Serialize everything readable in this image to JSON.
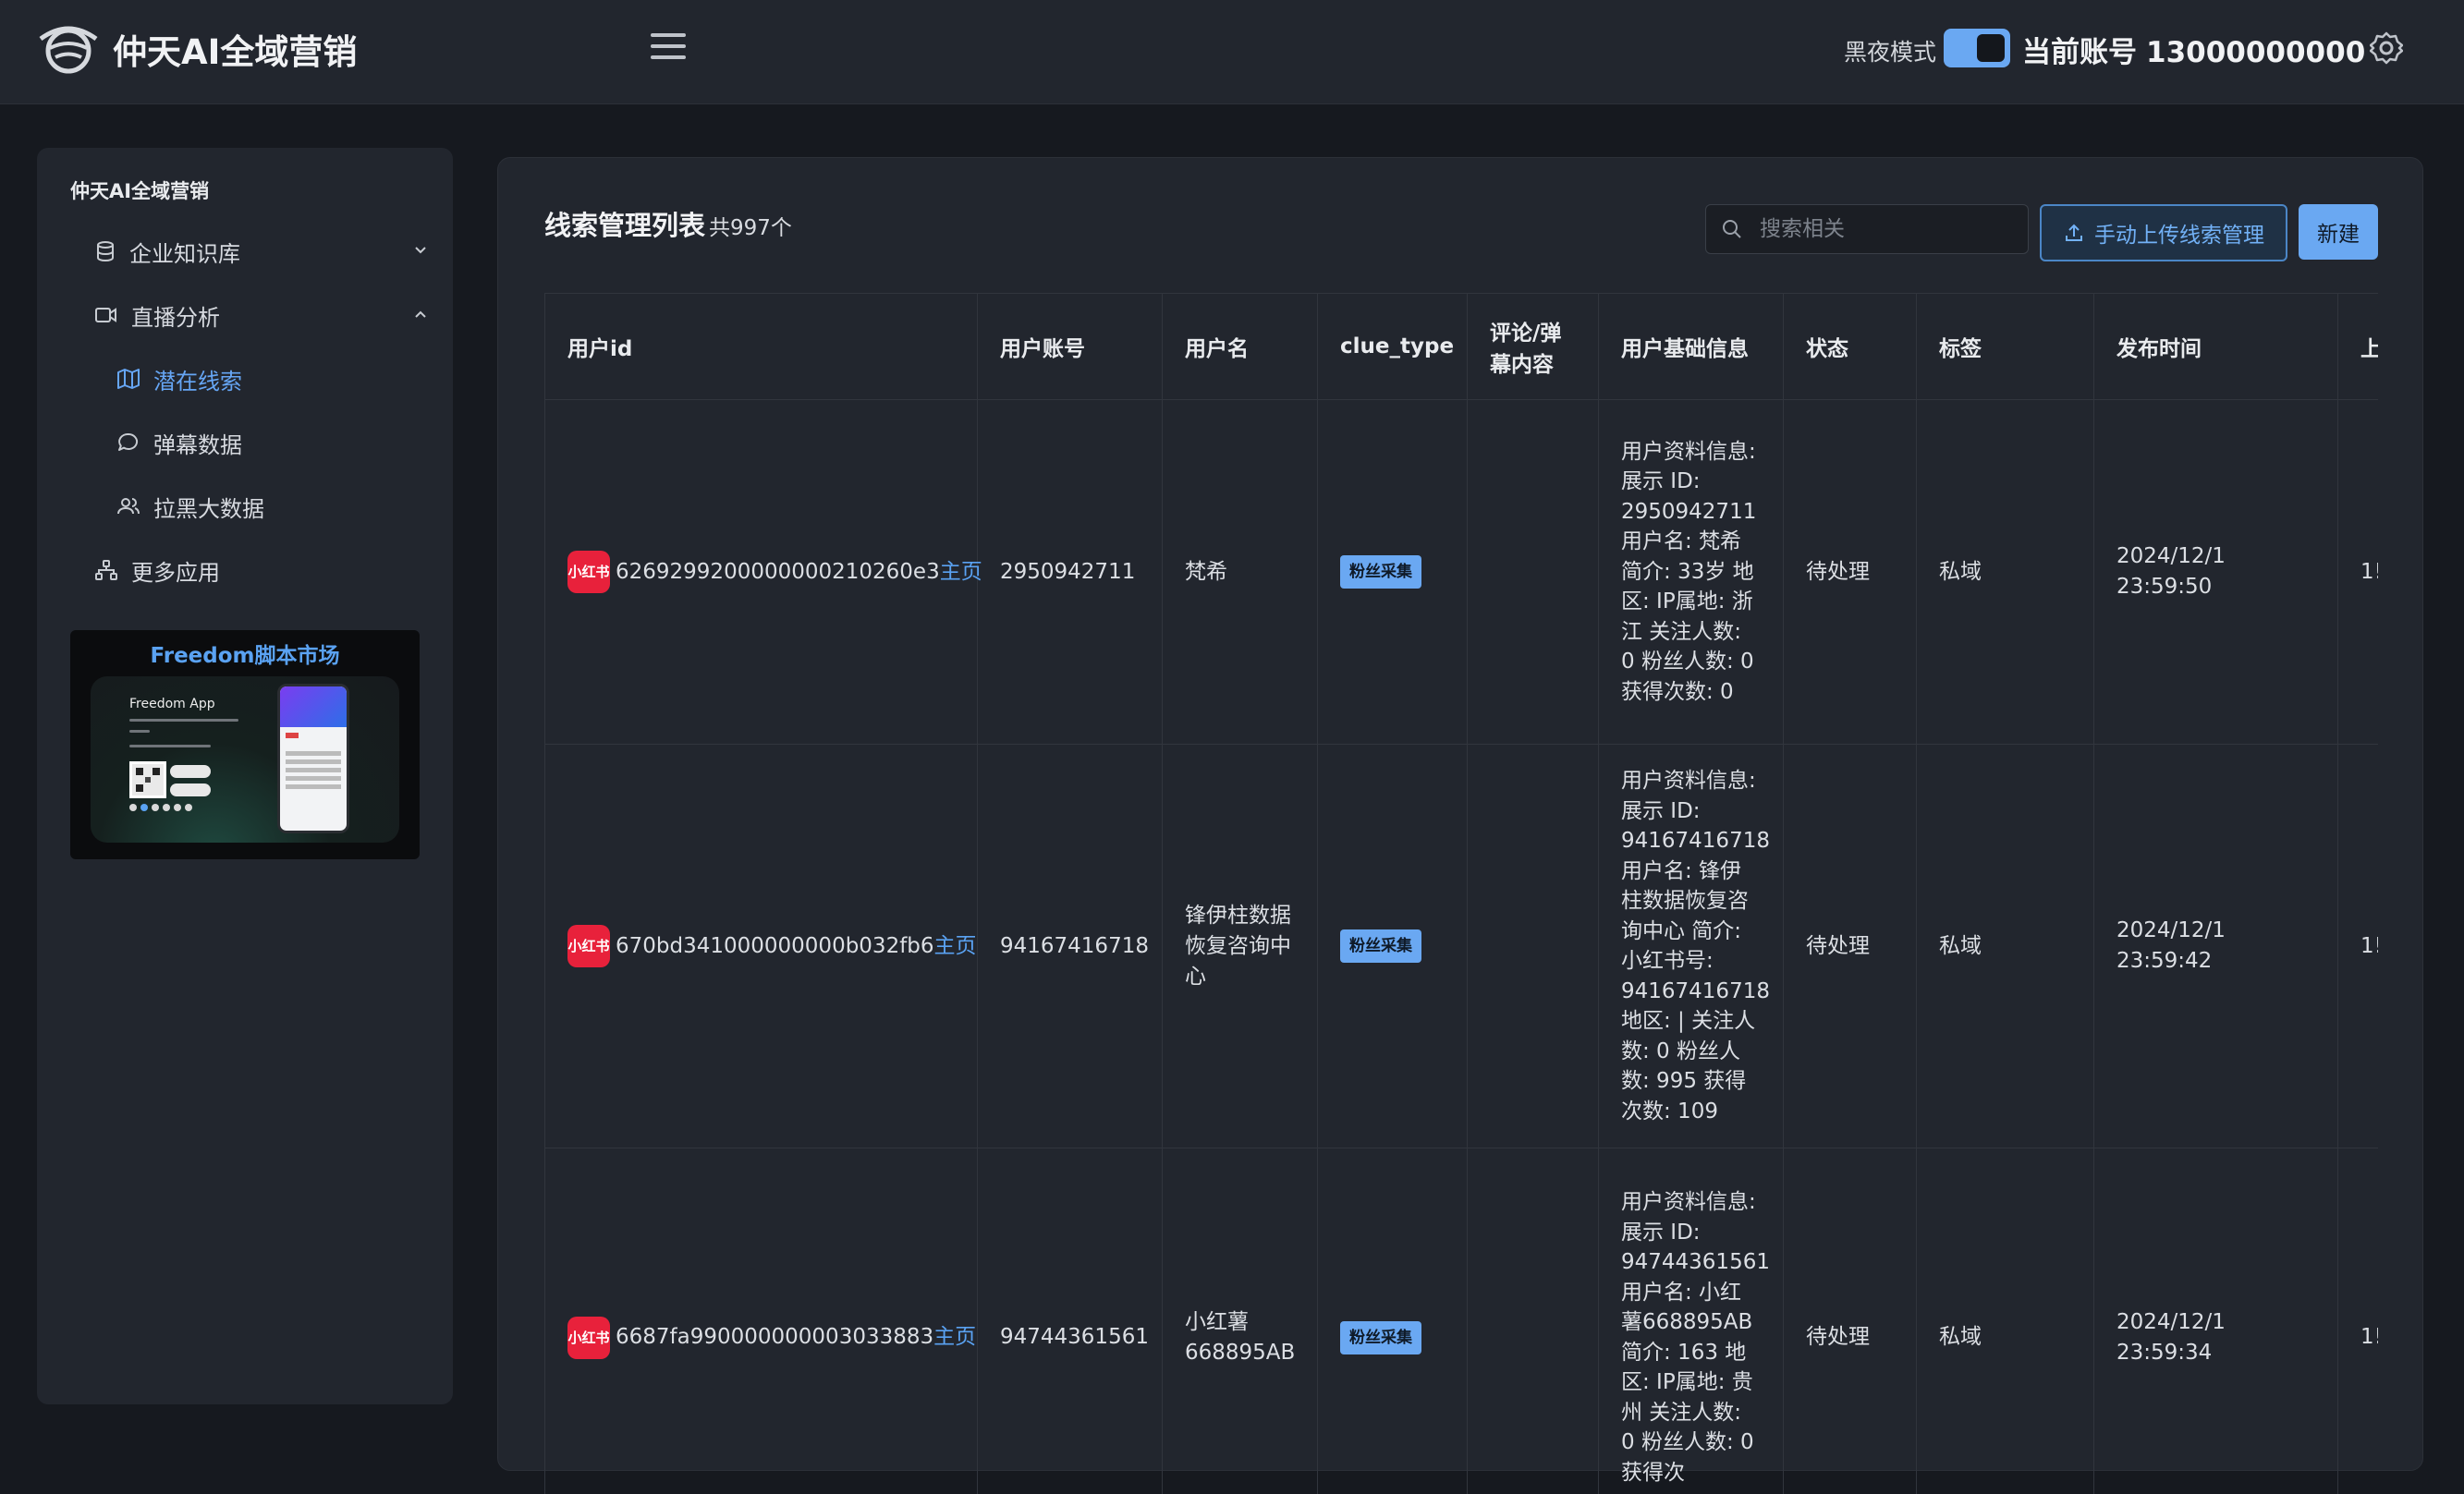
{
  "header": {
    "app_title": "仲天AI全域营销",
    "dark_mode_label": "黑夜模式",
    "dark_mode_on": true,
    "account_label": "当前账号",
    "account_number": "13000000000"
  },
  "sidebar": {
    "title": "仲天AI全域营销",
    "items": [
      {
        "label": "企业知识库",
        "icon": "database-icon",
        "expanded": false
      },
      {
        "label": "直播分析",
        "icon": "video-icon",
        "expanded": true
      },
      {
        "label": "潜在线索",
        "icon": "map-icon",
        "active": true
      },
      {
        "label": "弹幕数据",
        "icon": "chat-bubble-icon"
      },
      {
        "label": "拉黑大数据",
        "icon": "users-icon"
      },
      {
        "label": "更多应用",
        "icon": "sitemap-icon"
      }
    ],
    "promo": {
      "title": "Freedom脚本市场",
      "app_name": "Freedom App"
    }
  },
  "main": {
    "title": "线索管理列表",
    "count_text": "共997个",
    "search_placeholder": "搜索相关",
    "upload_label": "手动上传线索管理",
    "new_label": "新建",
    "columns": [
      "用户id",
      "用户账号",
      "用户名",
      "clue_type",
      "评论/弹幕内容",
      "用户基础信息",
      "状态",
      "标签",
      "发布时间",
      "上"
    ],
    "rows": [
      {
        "user_id": "6269299200000000210260e3",
        "home_link": "主页",
        "account": "2950942711",
        "username": "梵希",
        "clue_type": "粉丝采集",
        "comment": "",
        "basic_info": "用户资料信息: 展示 ID: 2950942711 用户名: 梵希 简介: 33岁 地区: IP属地: 浙江 关注人数: 0 粉丝人数: 0 获得次数: 0",
        "status": "待处理",
        "tag": "私域",
        "publish_time": "2024/12/1 23:59:50",
        "extra": "1!"
      },
      {
        "user_id": "670bd341000000000b032fb6",
        "home_link": "主页",
        "account": "94167416718",
        "username": "锋伊柱数据恢复咨询中心",
        "clue_type": "粉丝采集",
        "comment": "",
        "basic_info": "用户资料信息: 展示 ID: 94167416718 用户名: 锋伊柱数据恢复咨询中心  简介: 小红书号: 94167416718 地区: | 关注人数: 0 粉丝人数: 995 获得次数: 109",
        "status": "待处理",
        "tag": "私域",
        "publish_time": "2024/12/1 23:59:42",
        "extra": "1!"
      },
      {
        "user_id": "6687fa990000000003033883",
        "home_link": "主页",
        "account": "94744361561",
        "username": "小红薯668895AB",
        "clue_type": "粉丝采集",
        "comment": "",
        "basic_info": "用户资料信息: 展示 ID: 94744361561 用户名: 小红薯668895AB 简介: 163 地区: IP属地: 贵州 关注人数: 0 粉丝人数: 0 获得次",
        "status": "待处理",
        "tag": "私域",
        "publish_time": "2024/12/1 23:59:34",
        "extra": "1!"
      }
    ]
  },
  "colors": {
    "accent": "#6aa8f2",
    "link": "#5aa2f2",
    "xiaohongshu_red": "#e8213b",
    "panel_bg": "#22262e",
    "page_bg": "#16191f"
  }
}
